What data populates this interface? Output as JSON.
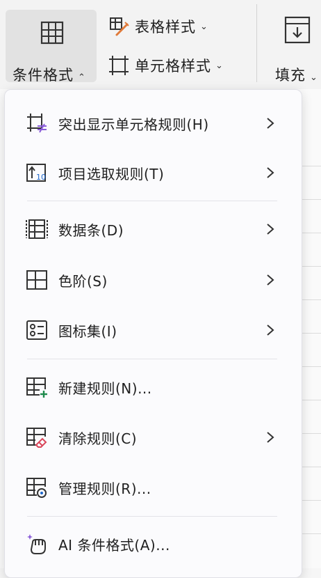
{
  "ribbon": {
    "conditional_format": {
      "label": "条件格式",
      "chevron": "⌃"
    },
    "table_style": {
      "label": "表格样式",
      "chevron": "⌄"
    },
    "cell_style": {
      "label": "单元格样式",
      "chevron": "⌄"
    },
    "fill": {
      "label": "填充",
      "chevron": "⌄"
    }
  },
  "menu": {
    "items": [
      {
        "label": "突出显示单元格规则(H)",
        "icon": "highlight-rules-icon",
        "submenu": true
      },
      {
        "label": "项目选取规则(T)",
        "icon": "top-bottom-rules-icon",
        "submenu": true
      },
      {
        "label": "数据条(D)",
        "icon": "data-bars-icon",
        "submenu": true
      },
      {
        "label": "色阶(S)",
        "icon": "color-scales-icon",
        "submenu": true
      },
      {
        "label": "图标集(I)",
        "icon": "icon-sets-icon",
        "submenu": true
      },
      {
        "label": "新建规则(N)...",
        "icon": "new-rule-icon",
        "submenu": false
      },
      {
        "label": "清除规则(C)",
        "icon": "clear-rules-icon",
        "submenu": true
      },
      {
        "label": "管理规则(R)...",
        "icon": "manage-rules-icon",
        "submenu": false
      },
      {
        "label": "AI 条件格式(A)...",
        "icon": "ai-format-icon",
        "submenu": false
      }
    ]
  },
  "colors": {
    "accent_green": "#1e8a4c",
    "accent_red": "#d9465a",
    "accent_purple": "#8a5cd8",
    "accent_orange": "#e07a3a"
  }
}
